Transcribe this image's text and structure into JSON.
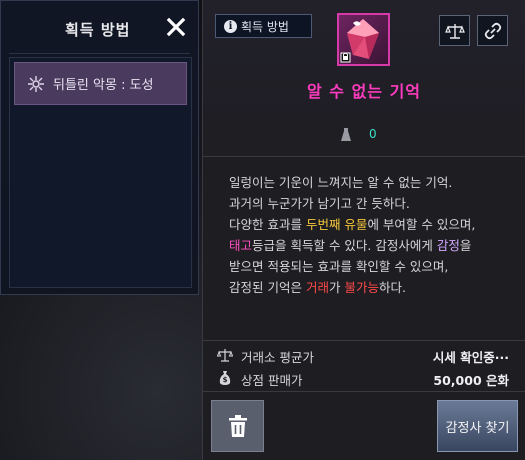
{
  "left_panel": {
    "title": "획득 방법",
    "close_icon": "close-icon",
    "methods": [
      {
        "label": "뒤틀린 악몽 : 도성",
        "icon": "dungeon-icon"
      }
    ]
  },
  "item": {
    "acquisition_button": "획득 방법",
    "name": "알 수 없는 기억",
    "count": "0",
    "description": {
      "l1": "일렁이는 기운이 느껴지는 알 수 없는 기억.",
      "l2": "과거의 누군가가 남기고 간 듯하다.",
      "l3a": "다양한 효과를 ",
      "l3b": "두번째 유물",
      "l3c": "에 부여할 수 있으며,",
      "l4a": "태고",
      "l4b": "등급을 획득할 수 있다. 감정사에게 ",
      "l4c": "감정",
      "l4d": "을",
      "l5": "받으면 적용되는 효과를 확인할 수 있으며,",
      "l6a": "감정된 기억은 ",
      "l6b": "거래",
      "l6c": "가 ",
      "l6d": "불가능",
      "l6e": "하다."
    },
    "market_label": "거래소 평균가",
    "market_value": "시세 확인중···",
    "shop_label": "상점 판매가",
    "shop_value": "50,000 은화",
    "appraise_button": "감정사 찾기"
  },
  "colors": {
    "item_name": "#ff3cbf",
    "count": "#3ce0c8",
    "highlight_yellow": "#f4c53a",
    "highlight_pink": "#ff4fbf",
    "highlight_red": "#ff4a4a"
  }
}
